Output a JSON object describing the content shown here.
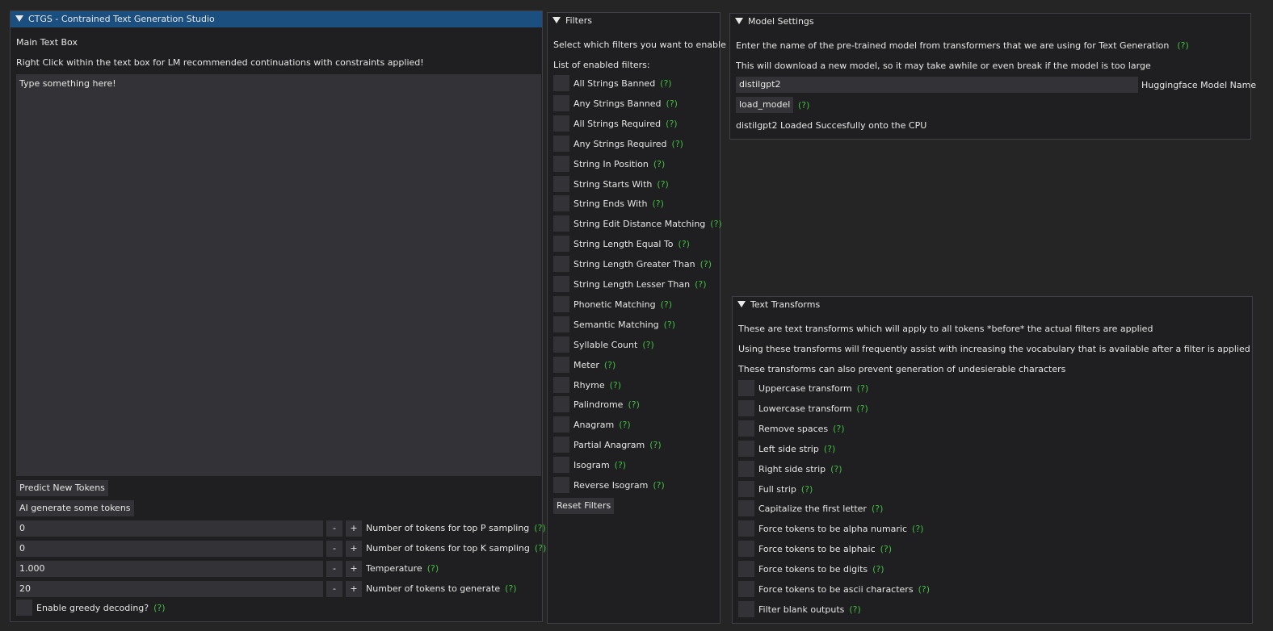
{
  "main_window": {
    "title": "CTGS - Contrained Text Generation Studio",
    "main_text_label": "Main Text Box",
    "hint": "Right Click within the text box for LM recommended continuations with constraints applied!",
    "textbox_value": "Type something here!",
    "predict_button": "Predict New Tokens",
    "generate_button": "AI generate some tokens",
    "params": [
      {
        "value": "0",
        "label": "Number of tokens for top P sampling"
      },
      {
        "value": "0",
        "label": "Number of tokens for top K sampling"
      },
      {
        "value": "1.000",
        "label": "Temperature"
      },
      {
        "value": "20",
        "label": "Number of tokens to generate"
      }
    ],
    "minus": "-",
    "plus": "+",
    "greedy_label": "Enable greedy decoding?"
  },
  "help_marker": "(?)",
  "filters_window": {
    "title": "Filters",
    "intro": "Select which filters you want to enable",
    "list_label": "List of enabled filters:",
    "items": [
      "All Strings Banned",
      "Any Strings Banned",
      "All Strings Required",
      "Any Strings Required",
      "String In Position",
      "String Starts With",
      "String Ends With",
      "String Edit Distance Matching",
      "String Length Equal To",
      "String Length Greater Than",
      "String Length Lesser Than",
      "Phonetic Matching",
      "Semantic Matching",
      "Syllable Count",
      "Meter",
      "Rhyme",
      "Palindrome",
      "Anagram",
      "Partial Anagram",
      "Isogram",
      "Reverse Isogram"
    ],
    "reset_button": "Reset Filters"
  },
  "model_window": {
    "title": "Model Settings",
    "line1": "Enter the name of the pre-trained model from transformers that we are using for Text Generation",
    "line2": "This will download a new model, so it may take awhile or even break if the model is too large",
    "model_value": "distilgpt2",
    "model_label": "Huggingface Model Name",
    "load_button": "load_model",
    "status": "distilgpt2 Loaded Succesfully onto the CPU"
  },
  "transforms_window": {
    "title": "Text Transforms",
    "line1": "These are text transforms which will apply to all tokens *before* the actual filters are applied",
    "line2": "Using these transforms will frequently assist with increasing the vocabulary that is available after a filter is applied",
    "line3": "These transforms can also prevent generation of undesierable characters",
    "items": [
      "Uppercase transform",
      "Lowercase transform",
      "Remove spaces",
      "Left side strip",
      "Right side strip",
      "Full strip",
      "Capitalize the first letter",
      "Force tokens to be alpha numaric",
      "Force tokens to be alphaic",
      "Force tokens to be digits",
      "Force tokens to be ascii characters",
      "Filter blank outputs"
    ]
  }
}
